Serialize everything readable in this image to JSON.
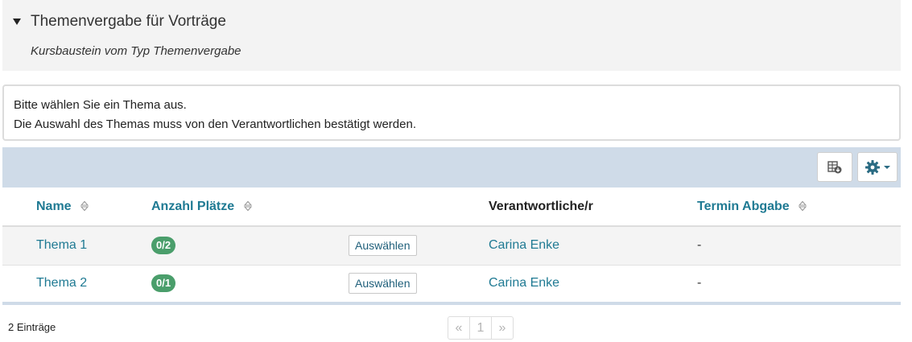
{
  "header": {
    "title": "Themenvergabe für Vorträge",
    "subtitle": "Kursbaustein vom Typ Themenvergabe"
  },
  "info": {
    "line1": "Bitte wählen Sie ein Thema aus.",
    "line2": "Die Auswahl des Themas muss von den Verantwortlichen bestätigt werden."
  },
  "toolbar": {
    "export_icon": "table-export-icon",
    "settings_icon": "gear-icon"
  },
  "table": {
    "columns": {
      "name": "Name",
      "places": "Anzahl Plätze",
      "responsible": "Verantwortliche/r",
      "deadline": "Termin Abgabe"
    },
    "rows": [
      {
        "name": "Thema 1",
        "places": "0/2",
        "action": "Auswählen",
        "responsible": "Carina Enke",
        "deadline": "-"
      },
      {
        "name": "Thema 2",
        "places": "0/1",
        "action": "Auswählen",
        "responsible": "Carina Enke",
        "deadline": "-"
      }
    ]
  },
  "footer": {
    "count": "2 Einträge",
    "pager": {
      "prev": "«",
      "page": "1",
      "next": "»"
    }
  },
  "colors": {
    "link": "#1f7a93",
    "badge": "#4a9e6b",
    "toolbar_bg": "#cfdbe8"
  }
}
